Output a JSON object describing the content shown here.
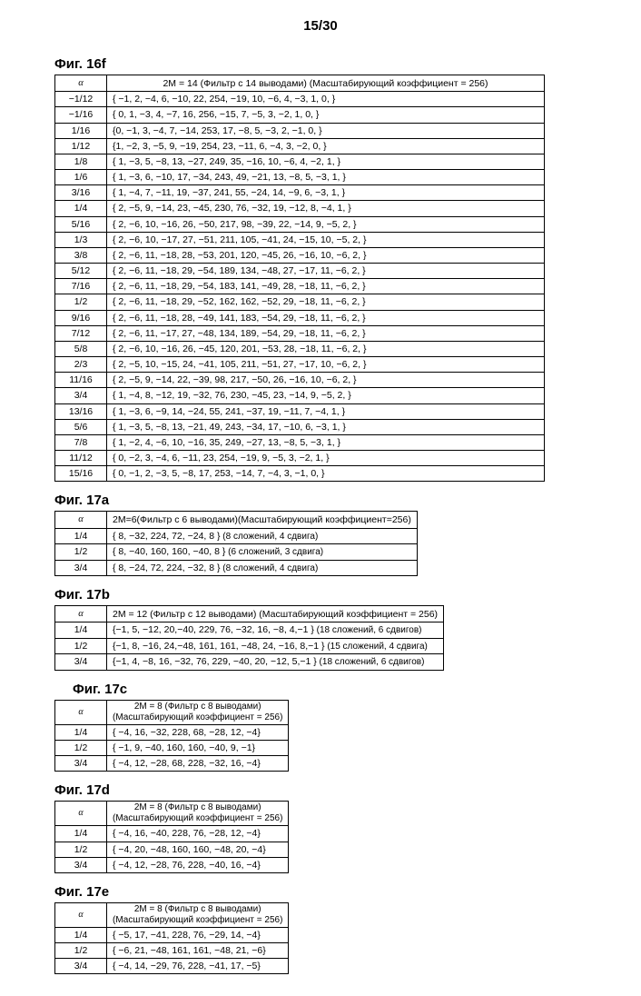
{
  "page_number": "15/30",
  "alpha_symbol": "α",
  "fig16f": {
    "label": "Фиг. 16f",
    "header": "2M = 14 (Фильтр с 14 выводами) (Масштабирующий коэффициент = 256)",
    "rows": [
      {
        "a": "−1/12",
        "c": "{ −1, 2, −4, 6, −10, 22, 254, −19, 10, −6, 4, −3, 1, 0, }"
      },
      {
        "a": "−1/16",
        "c": "{ 0, 1, −3, 4, −7, 16, 256, −15, 7, −5, 3, −2, 1, 0, }"
      },
      {
        "a": "1/16",
        "c": "{0, −1, 3, −4, 7, −14, 253, 17, −8, 5, −3, 2, −1, 0, }"
      },
      {
        "a": "1/12",
        "c": "{1, −2, 3, −5, 9, −19, 254, 23, −11, 6, −4, 3, −2, 0, }"
      },
      {
        "a": "1/8",
        "c": "{ 1, −3, 5, −8, 13, −27, 249, 35, −16, 10, −6, 4, −2, 1, }"
      },
      {
        "a": "1/6",
        "c": "{ 1, −3, 6, −10, 17, −34, 243, 49, −21, 13, −8, 5, −3, 1, }"
      },
      {
        "a": "3/16",
        "c": "{ 1, −4, 7, −11, 19, −37, 241, 55, −24, 14, −9, 6, −3, 1, }"
      },
      {
        "a": "1/4",
        "c": "{ 2, −5, 9, −14, 23, −45, 230, 76, −32, 19, −12, 8, −4, 1, }"
      },
      {
        "a": "5/16",
        "c": "{ 2, −6, 10, −16, 26, −50, 217, 98, −39, 22, −14, 9, −5, 2, }"
      },
      {
        "a": "1/3",
        "c": "{ 2, −6, 10, −17, 27, −51, 211, 105, −41, 24, −15, 10, −5, 2, }"
      },
      {
        "a": "3/8",
        "c": "{ 2, −6, 11, −18, 28, −53, 201, 120, −45, 26, −16, 10, −6, 2, }"
      },
      {
        "a": "5/12",
        "c": "{ 2, −6, 11, −18, 29, −54, 189, 134, −48, 27, −17, 11, −6, 2, }"
      },
      {
        "a": "7/16",
        "c": "{ 2, −6, 11, −18, 29, −54, 183, 141, −49, 28, −18, 11, −6, 2, }"
      },
      {
        "a": "1/2",
        "c": "{ 2, −6, 11, −18, 29, −52, 162, 162, −52, 29, −18, 11, −6, 2, }"
      },
      {
        "a": "9/16",
        "c": "{ 2, −6, 11, −18, 28, −49, 141, 183, −54, 29, −18, 11, −6, 2, }"
      },
      {
        "a": "7/12",
        "c": "{ 2, −6, 11, −17, 27, −48, 134, 189, −54, 29, −18, 11, −6, 2, }"
      },
      {
        "a": "5/8",
        "c": "{ 2, −6, 10, −16, 26, −45, 120, 201, −53, 28, −18, 11, −6, 2, }"
      },
      {
        "a": "2/3",
        "c": "{ 2, −5, 10, −15, 24, −41, 105, 211, −51, 27, −17, 10, −6, 2, }"
      },
      {
        "a": "11/16",
        "c": "{ 2, −5, 9, −14, 22, −39, 98, 217, −50, 26, −16, 10, −6, 2, }"
      },
      {
        "a": "3/4",
        "c": "{ 1, −4, 8, −12, 19, −32, 76, 230, −45, 23, −14, 9, −5, 2, }"
      },
      {
        "a": "13/16",
        "c": "{ 1, −3, 6, −9, 14, −24, 55, 241, −37, 19, −11, 7, −4, 1, }"
      },
      {
        "a": "5/6",
        "c": "{ 1, −3, 5, −8, 13, −21, 49, 243, −34, 17, −10, 6, −3, 1, }"
      },
      {
        "a": "7/8",
        "c": "{ 1, −2, 4, −6, 10, −16, 35, 249, −27, 13, −8, 5, −3, 1, }"
      },
      {
        "a": "11/12",
        "c": "{ 0, −2, 3, −4, 6, −11, 23, 254, −19, 9, −5, 3, −2, 1, }"
      },
      {
        "a": "15/16",
        "c": "{ 0, −1, 2, −3, 5, −8, 17, 253, −14, 7, −4, 3, −1, 0, }"
      }
    ]
  },
  "fig17a": {
    "label": "Фиг. 17a",
    "header": "2M=6(Фильтр с 6 выводами)(Масштабирующий коэффициент=256)",
    "rows": [
      {
        "a": "1/4",
        "c": "{  8, −32, 224,  72, −24,  8 }",
        "n": " (8 сложений, 4 сдвига)"
      },
      {
        "a": "1/2",
        "c": "{  8, −40, 160, 160, −40,  8 }",
        "n": " (6 сложений, 3 сдвига)"
      },
      {
        "a": "3/4",
        "c": "{  8, −24,  72, 224, −32,  8 }",
        "n": "  (8 сложений, 4 сдвига)"
      }
    ]
  },
  "fig17b": {
    "label": "Фиг. 17b",
    "header": "2M = 12 (Фильтр с 12 выводами) (Масштабирующий коэффициент = 256)",
    "rows": [
      {
        "a": "1/4",
        "c": "{−1, 5, −12, 20,−40, 229, 76, −32, 16, −8, 4,−1  }",
        "n": "(18 сложений, 6 сдвигов)"
      },
      {
        "a": "1/2",
        "c": "{−1, 8, −16, 24,−48, 161, 161, −48, 24, −16, 8,−1 }",
        "n": "(15 сложений, 4 сдвига)"
      },
      {
        "a": "3/4",
        "c": "{−1, 4, −8, 16, −32, 76, 229, −40, 20, −12, 5,−1  }",
        "n": "(18 сложений, 6 сдвигов)"
      }
    ]
  },
  "fig17c": {
    "label": "Фиг. 17c",
    "header1": "2M = 8 (Фильтр с 8 выводами)",
    "header2": "(Масштабирующий коэффициент = 256)",
    "rows": [
      {
        "a": "1/4",
        "c": "{ −4,  16,  −32,  228,   68,  −28,  12,  −4}"
      },
      {
        "a": "1/2",
        "c": "{ −1,   9,  −40,  160,  160,  −40,   9,  −1}"
      },
      {
        "a": "3/4",
        "c": "{ −4,  12,  −28,   68,  228,  −32,  16,  −4}"
      }
    ]
  },
  "fig17d": {
    "label": "Фиг. 17d",
    "header1": "2M = 8 (Фильтр с 8 выводами)",
    "header2": "(Масштабирующий коэффициент = 256)",
    "rows": [
      {
        "a": "1/4",
        "c": "{ −4,  16,  −40,  228,   76,  −28,  12,  −4}"
      },
      {
        "a": "1/2",
        "c": "{ −4,  20,  −48,  160,  160,  −48,  20,  −4}"
      },
      {
        "a": "3/4",
        "c": "{ −4,  12,  −28,   76,  228,  −40,  16,  −4}"
      }
    ]
  },
  "fig17e": {
    "label": "Фиг. 17e",
    "header1": "2M = 8 (Фильтр с 8 выводами)",
    "header2": "(Масштабирующий коэффициент = 256)",
    "rows": [
      {
        "a": "1/4",
        "c": "{ −5,  17,  −41,  228,   76,  −29,  14,  −4}"
      },
      {
        "a": "1/2",
        "c": "{ −6,  21,  −48,  161,  161,  −48,  21,  −6}"
      },
      {
        "a": "3/4",
        "c": "{ −4,  14,  −29,   76,  228,  −41,  17,  −5}"
      }
    ]
  }
}
